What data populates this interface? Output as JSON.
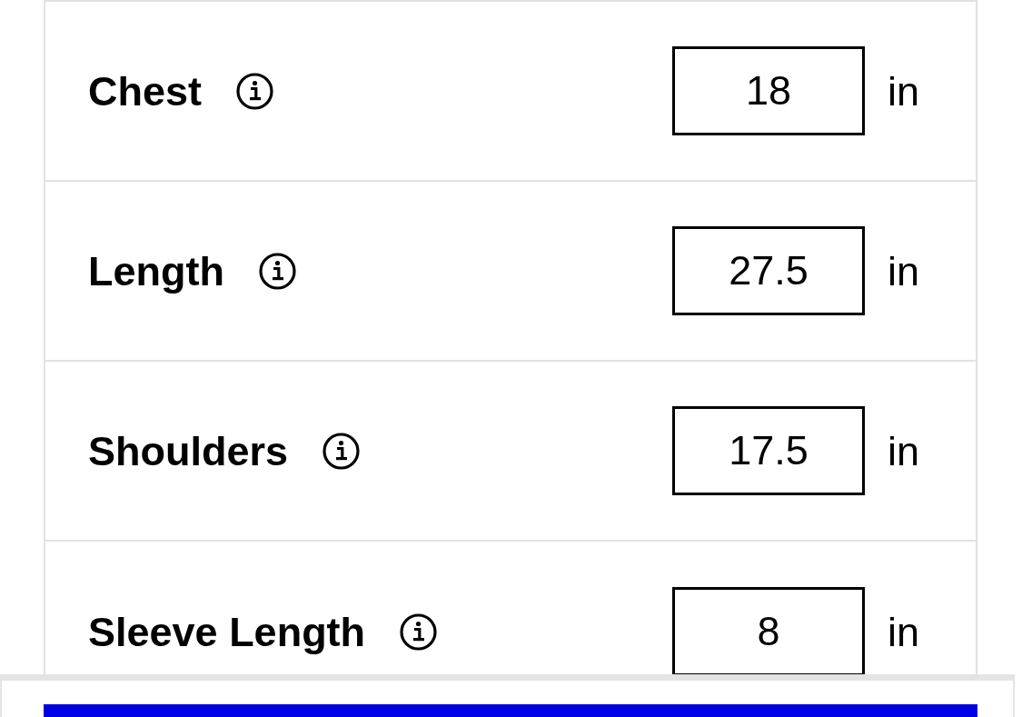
{
  "measurements": [
    {
      "label": "Chest",
      "value": "18",
      "unit": "in"
    },
    {
      "label": "Length",
      "value": "27.5",
      "unit": "in"
    },
    {
      "label": "Shoulders",
      "value": "17.5",
      "unit": "in"
    },
    {
      "label": "Sleeve Length",
      "value": "8",
      "unit": "in"
    }
  ]
}
